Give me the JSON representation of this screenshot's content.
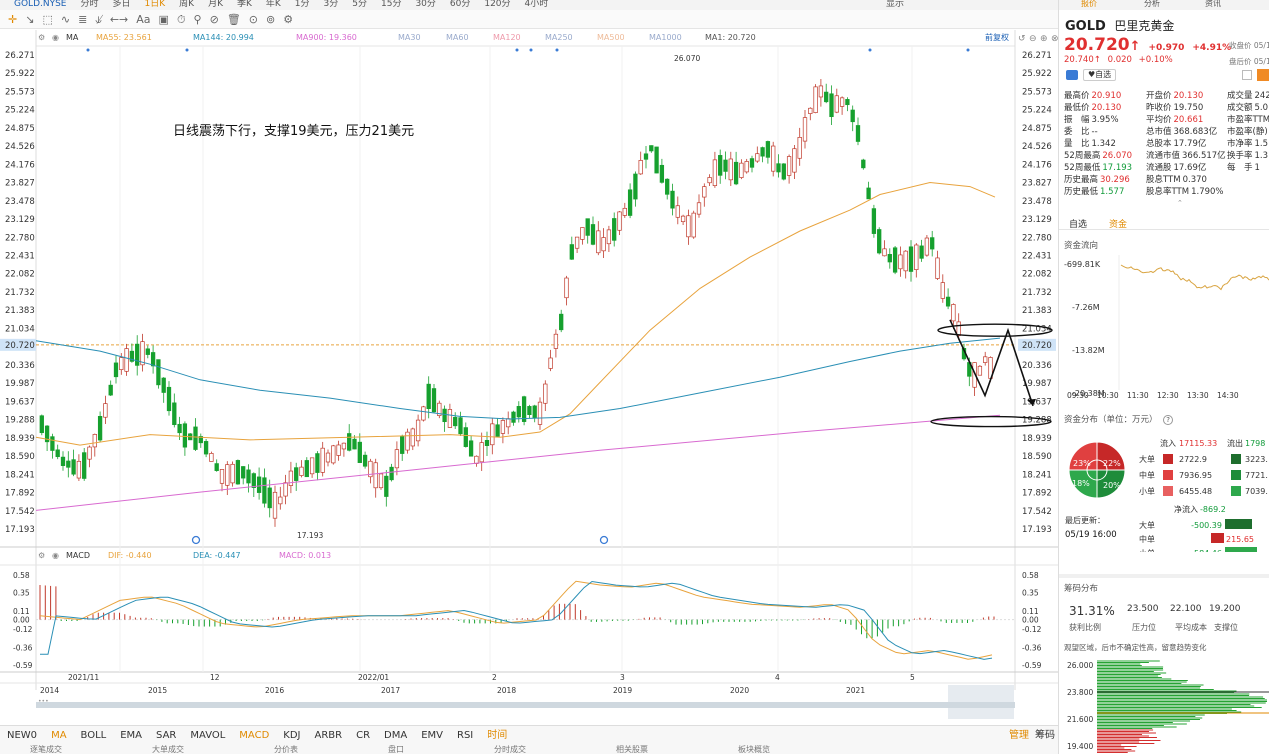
{
  "toolbar": {
    "symbol": "GOLD.NYSE",
    "periods": [
      "分时",
      "多日",
      "1日K",
      "周K",
      "月K",
      "季K",
      "年K",
      "1分",
      "3分",
      "5分",
      "15分",
      "30分",
      "60分",
      "120分",
      "4小时"
    ],
    "active_period": "1日K",
    "right_items": [
      "显示"
    ]
  },
  "drawtools": [
    "✛",
    "↘",
    "⬚",
    "∿",
    "≣",
    "⫝̸",
    "←→",
    "Aa",
    "▣",
    "⏱",
    "⚲",
    "⊘",
    "🗑",
    "⊙",
    "⊚",
    "⚙"
  ],
  "legend": {
    "ma_label": "MA",
    "ma55": "MA55: 23.561",
    "ma144": "MA144: 20.994",
    "ma900": "MA900: 19.360",
    "ma_empty": [
      "MA30",
      "MA60",
      "MA120",
      "MA250",
      "MA500",
      "MA1000"
    ],
    "ma1": "MA1: 20.720",
    "adjust": "前复权"
  },
  "price_axis": [
    "26.271",
    "25.922",
    "25.573",
    "25.224",
    "24.875",
    "24.526",
    "24.176",
    "23.827",
    "23.478",
    "23.129",
    "22.780",
    "22.431",
    "22.082",
    "21.732",
    "21.383",
    "21.034",
    "20.720",
    "20.336",
    "19.987",
    "19.637",
    "19.288",
    "18.939",
    "18.590",
    "18.241",
    "17.892",
    "17.542",
    "17.193"
  ],
  "current_price": "20.720",
  "annotation": "日线震荡下行，支撑19美元，压力21美元",
  "high_label": "26.070",
  "low_label": "17.193",
  "macd_legend": {
    "label": "MACD",
    "dif": "DIF: -0.440",
    "dea": "DEA: -0.447",
    "macd": "MACD: 0.013"
  },
  "macd_axis": [
    "0.58",
    "0.35",
    "0.11",
    "0.00",
    "-0.12",
    "-0.36",
    "-0.59"
  ],
  "date_axis_top": [
    "2021/11",
    "12",
    "2022/01",
    "2",
    "3",
    "4",
    "5"
  ],
  "date_axis_bottom": [
    "2014",
    "2015",
    "2016",
    "2017",
    "2018",
    "2019",
    "2020",
    "2021",
    "2022"
  ],
  "indicators": [
    "NEW0",
    "MA",
    "BOLL",
    "EMA",
    "SAR",
    "MAVOL",
    "MACD",
    "KDJ",
    "ARBR",
    "CR",
    "DMA",
    "EMV",
    "RSI",
    "时间"
  ],
  "indicators_selected": [
    "MA",
    "MACD"
  ],
  "indicators_right": [
    "管理",
    "筹码"
  ],
  "bottom_row": [
    "逐笔成交",
    "大单成交",
    "分价表",
    "盘口",
    "分时成交",
    "相关股票",
    "板块概览"
  ],
  "panel": {
    "tabs": [
      "报价",
      "分析",
      "资讯"
    ],
    "code": "GOLD",
    "name": "巴里克黄金",
    "price": "20.720",
    "change": "+0.970",
    "change_pct": "+4.91%",
    "close_label": "收盘价 05/19 16",
    "after_price": "20.740",
    "after_change": "0.020",
    "after_pct": "+0.10%",
    "after_label": "盘后价 05/19 19",
    "watch_btn": "自选",
    "stats": [
      [
        "最高价",
        "20.910",
        "red"
      ],
      [
        "开盘价",
        "20.130",
        "red"
      ],
      [
        "成交量",
        "242",
        ""
      ],
      [
        "最低价",
        "20.130",
        "red"
      ],
      [
        "昨收价",
        "19.750",
        ""
      ],
      [
        "成交额",
        "5.0",
        ""
      ],
      [
        "振　幅",
        "3.95%",
        ""
      ],
      [
        "平均价",
        "20.661",
        "red"
      ],
      [
        "市盈率TTM",
        "",
        ""
      ],
      [
        "委　比",
        "--",
        ""
      ],
      [
        "总市值",
        "368.683亿",
        ""
      ],
      [
        "市盈率(静)",
        "",
        ""
      ],
      [
        "量　比",
        "1.342",
        ""
      ],
      [
        "总股本",
        "17.79亿",
        ""
      ],
      [
        "市净率",
        "1.5",
        ""
      ],
      [
        "52周最高",
        "26.070",
        "red"
      ],
      [
        "流通市值",
        "366.517亿",
        ""
      ],
      [
        "换手率",
        "1.3",
        ""
      ],
      [
        "52周最低",
        "17.193",
        "green"
      ],
      [
        "流通股",
        "17.69亿",
        ""
      ],
      [
        "每　手",
        "1",
        ""
      ],
      [
        "历史最高",
        "30.296",
        "red"
      ],
      [
        "股息TTM",
        "0.370",
        ""
      ],
      [
        "",
        "",
        ""
      ],
      [
        "历史最低",
        "1.577",
        "green"
      ],
      [
        "股息率TTM",
        "1.790%",
        ""
      ],
      [
        "",
        "",
        ""
      ]
    ],
    "fund_tabs": [
      "自选",
      "资金"
    ],
    "fund_flow_title": "资金流向",
    "flow_axis": [
      "-699.81K",
      "-7.26M",
      "-13.82M",
      "-20.38M"
    ],
    "flow_times": [
      "09:30",
      "10:30",
      "11:30",
      "12:30",
      "13:30",
      "14:30"
    ],
    "dist_title": "资金分布（单位：万元）",
    "inflow_label": "流入",
    "inflow_total": "17115.33",
    "outflow_label": "流出",
    "outflow_total": "1798",
    "dist_rows": [
      {
        "label": "大单",
        "in": "2722.9",
        "out": "3223."
      },
      {
        "label": "中单",
        "in": "7936.95",
        "out": "7721."
      },
      {
        "label": "小单",
        "in": "6455.48",
        "out": "7039."
      }
    ],
    "pie_labels": [
      "23%",
      "22%",
      "18%",
      "20%"
    ],
    "net_label": "净流入",
    "net_value": "-869.2",
    "update_label": "最后更新：",
    "update_time": "05/19 16:00",
    "net_rows": [
      {
        "label": "大单",
        "value": "-500.39"
      },
      {
        "label": "中单",
        "value": "215.65"
      },
      {
        "label": "小单",
        "value": "-584.46"
      }
    ],
    "chip_title": "筹码分布",
    "chip_values": [
      "31.31%",
      "23.500",
      "22.100",
      "19.200"
    ],
    "chip_labels": [
      "获利比例",
      "压力位",
      "平均成本",
      "支撑位"
    ],
    "chip_note": "观望区域，后市不确定性高，留意趋势变化",
    "chip_axis": [
      "26.000",
      "23.800",
      "21.600",
      "19.400"
    ]
  },
  "colors": {
    "up": "#c0392b",
    "down": "#16a02e",
    "ma55": "#e8a33d",
    "ma144": "#2a8fb5",
    "ma900": "#d86ad0",
    "accent": "#e08a00"
  }
}
